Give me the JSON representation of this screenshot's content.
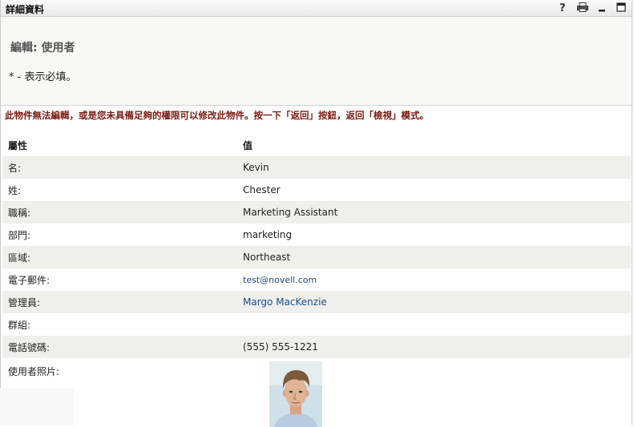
{
  "titlebar": {
    "title": "詳細資料",
    "help_icon": "help-icon",
    "print_icon": "printer-icon",
    "minimize_icon": "minimize-icon",
    "maximize_icon": "maximize-icon"
  },
  "header": {
    "edit_title": "編輯: 使用者",
    "required_note": "* - 表示必填。"
  },
  "warning": "此物件無法編輯，或是您未具備足夠的權限可以修改此物件。按一下「返回」按鈕，返回「檢視」模式。",
  "table": {
    "col_attribute": "屬性",
    "col_value": "值",
    "rows": [
      {
        "label": "名:",
        "value": "Kevin"
      },
      {
        "label": "姓:",
        "value": "Chester"
      },
      {
        "label": "職稱:",
        "value": "Marketing Assistant"
      },
      {
        "label": "部門:",
        "value": "marketing"
      },
      {
        "label": "區域:",
        "value": "Northeast"
      },
      {
        "label": "電子郵件:",
        "value": "test@novell.com"
      },
      {
        "label": "管理員:",
        "value": "Margo MacKenzie"
      },
      {
        "label": "群組:",
        "value": ""
      },
      {
        "label": "電話號碼:",
        "value": "(555) 555-1221"
      },
      {
        "label": "使用者照片:",
        "value": ""
      }
    ]
  }
}
